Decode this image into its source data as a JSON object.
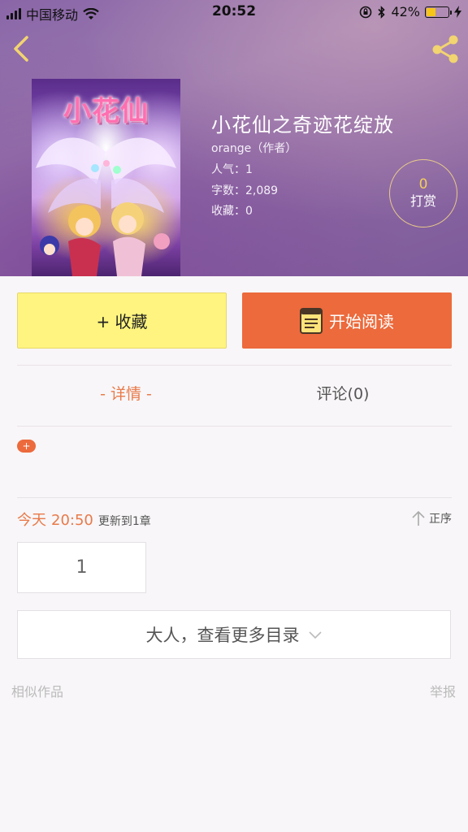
{
  "status_bar": {
    "carrier": "中国移动",
    "time": "20:52",
    "battery_text": "42%",
    "battery_level": 0.42
  },
  "header": {
    "back_icon": "chevron-left-icon",
    "share_icon": "share-icon"
  },
  "book": {
    "cover_title": "小花仙",
    "title": "小花仙之奇迹花绽放",
    "author": "orange（作者）",
    "popularity": "人气：1",
    "words": "字数：2,089",
    "favorites": "收藏：0"
  },
  "reward": {
    "count": "0",
    "label": "打赏"
  },
  "actions": {
    "favorite_label": "+ 收藏",
    "read_label": "开始阅读"
  },
  "tabs": {
    "detail": "- 详情 -",
    "comments": "评论(0)"
  },
  "tag_add_label": "+",
  "update": {
    "today": "今天",
    "time": "20:50",
    "text": "更新到1章"
  },
  "sort_label": "正序",
  "chapters": [
    "1"
  ],
  "more_catalog": "大人，查看更多目录",
  "footer": {
    "similar": "相似作品",
    "report": "举报"
  },
  "colors": {
    "accent_orange": "#ec6a3c",
    "favorite_yellow": "#fef47f",
    "reward_gold": "#f2cf5a"
  }
}
